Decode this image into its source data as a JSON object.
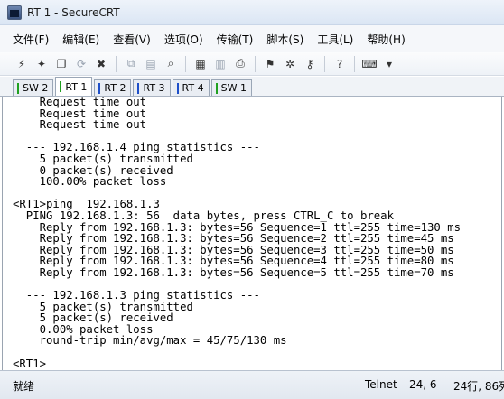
{
  "window": {
    "title": "RT 1 - SecureCRT"
  },
  "menu": [
    "文件(F)",
    "编辑(E)",
    "查看(V)",
    "选项(O)",
    "传输(T)",
    "脚本(S)",
    "工具(L)",
    "帮助(H)"
  ],
  "toolbar": {
    "buttons": [
      {
        "name": "connect-icon",
        "glyph": "⚡"
      },
      {
        "name": "quick-connect-icon",
        "glyph": "✦"
      },
      {
        "name": "connect-tab-icon",
        "glyph": "❐"
      },
      {
        "name": "reconnect-icon",
        "glyph": "⟳",
        "dim": true
      },
      {
        "name": "disconnect-icon",
        "glyph": "✖"
      },
      {
        "sep": true
      },
      {
        "name": "copy-icon",
        "glyph": "⧉",
        "dim": true
      },
      {
        "name": "paste-icon",
        "glyph": "▤",
        "dim": true
      },
      {
        "name": "find-icon",
        "glyph": "⌕"
      },
      {
        "sep": true
      },
      {
        "name": "print-setup-icon",
        "glyph": "▦"
      },
      {
        "name": "print-selection-icon",
        "glyph": "▥",
        "dim": true
      },
      {
        "name": "print-icon",
        "glyph": "⎙"
      },
      {
        "sep": true
      },
      {
        "name": "session-options-icon",
        "glyph": "⚑"
      },
      {
        "name": "global-options-icon",
        "glyph": "✲"
      },
      {
        "name": "key-icon",
        "glyph": "⚷"
      },
      {
        "sep": true
      },
      {
        "name": "help-icon",
        "glyph": "?"
      },
      {
        "sep": true
      },
      {
        "name": "keymap-icon",
        "glyph": "⌨"
      },
      {
        "name": "toolbar-overflow-icon",
        "glyph": "▾"
      }
    ]
  },
  "tabs": [
    {
      "label": "SW 2",
      "color": "#20a020",
      "active": false
    },
    {
      "label": "RT 1",
      "color": "#20a020",
      "active": true
    },
    {
      "label": "RT 2",
      "color": "#1e4fc8",
      "active": false
    },
    {
      "label": "RT 3",
      "color": "#1e4fc8",
      "active": false
    },
    {
      "label": "RT 4",
      "color": "#1e4fc8",
      "active": false
    },
    {
      "label": "SW 1",
      "color": "#20a020",
      "active": false
    }
  ],
  "terminal": {
    "lines": [
      "    Request time out",
      "    Request time out",
      "    Request time out",
      "",
      "  --- 192.168.1.4 ping statistics ---",
      "    5 packet(s) transmitted",
      "    0 packet(s) received",
      "    100.00% packet loss",
      "",
      "<RT1>ping  192.168.1.3",
      "  PING 192.168.1.3: 56  data bytes, press CTRL_C to break",
      "    Reply from 192.168.1.3: bytes=56 Sequence=1 ttl=255 time=130 ms",
      "    Reply from 192.168.1.3: bytes=56 Sequence=2 ttl=255 time=45 ms",
      "    Reply from 192.168.1.3: bytes=56 Sequence=3 ttl=255 time=50 ms",
      "    Reply from 192.168.1.3: bytes=56 Sequence=4 ttl=255 time=80 ms",
      "    Reply from 192.168.1.3: bytes=56 Sequence=5 ttl=255 time=70 ms",
      "",
      "  --- 192.168.1.3 ping statistics ---",
      "    5 packet(s) transmitted",
      "    5 packet(s) received",
      "    0.00% packet loss",
      "    round-trip min/avg/max = 45/75/130 ms",
      "",
      "<RT1>"
    ]
  },
  "status": {
    "ready": "就绪",
    "protocol": "Telnet",
    "position": "24,  6",
    "dimensions": "24行, 86列"
  }
}
